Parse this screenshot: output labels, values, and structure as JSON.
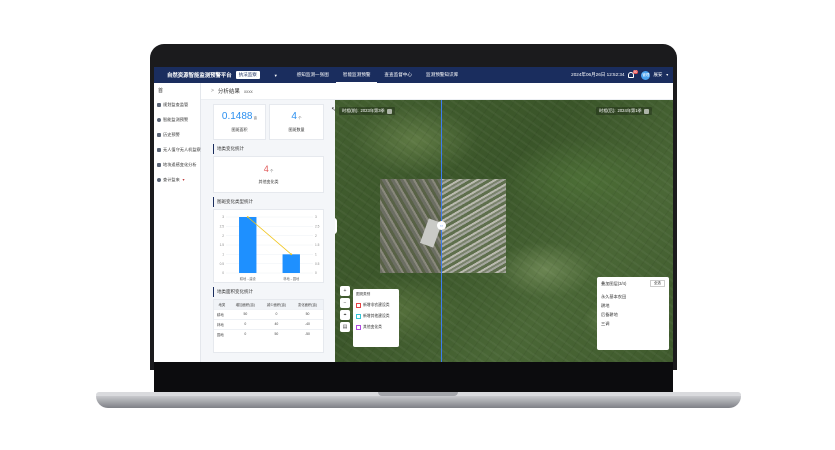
{
  "header": {
    "app_title": "自然资源智能监测预警平台",
    "mode_badge": "执法监察",
    "nav": [
      "感知监测一张图",
      "智能监测预警",
      "查查监督中心",
      "监测预警知识库"
    ],
    "active_nav_index": 1,
    "datetime": "2024年06月26日 12:52:34",
    "notification_count": "50",
    "user_initial": "管理",
    "user_name": "展安"
  },
  "sidebar": {
    "home_label": "首",
    "items": [
      {
        "label": "规划监查监管",
        "icon": "doc-icon"
      },
      {
        "label": "智能监测预警",
        "icon": "gear-icon"
      },
      {
        "label": "历史预警",
        "icon": "list-icon"
      },
      {
        "label": "无人值守无人机监察",
        "icon": "drone-icon"
      },
      {
        "label": "地块遥感变化分析",
        "icon": "monitor-icon"
      },
      {
        "label": "查计监来",
        "icon": "search-icon"
      }
    ]
  },
  "breadcrumb": {
    "title": "分析结果",
    "sub": "xxxx"
  },
  "stats": {
    "area_value": "0.1488",
    "area_unit": "亩",
    "area_label": "图斑面积",
    "count_value": "4",
    "count_unit": "个",
    "count_label": "图斑数量",
    "section_change": "地类变化统计",
    "change_value": "4",
    "change_unit": "个",
    "change_label": "其他变化类"
  },
  "chart_section_title": "图斑变化类型统计",
  "chart_data": {
    "type": "bar",
    "categories": [
      "耕地→建设",
      "林地→园地"
    ],
    "series": [
      {
        "values": [
          3,
          1
        ],
        "color": "#1e90ff"
      },
      {
        "values": [
          3,
          1
        ],
        "color": "#f0c419"
      }
    ],
    "ylim": [
      0,
      3
    ],
    "y_ticks": [
      "0",
      "0.5",
      "1",
      "1.5",
      "2",
      "2.5",
      "3"
    ],
    "y2_ticks": [
      "0",
      "0.5",
      "1",
      "1.5",
      "2",
      "2.5",
      "3"
    ]
  },
  "area_section_title": "地类面积变化统计",
  "area_table": {
    "headers": [
      "地类",
      "增加面积(亩)",
      "减少面积(亩)",
      "变化面积(亩)"
    ],
    "rows": [
      [
        "耕地",
        "50",
        "0",
        "50"
      ],
      [
        "林地",
        "0",
        "40",
        "-40"
      ],
      [
        "园地",
        "0",
        "50",
        "-50"
      ]
    ]
  },
  "map": {
    "left_time_label": "时相(前):",
    "left_time_value": "2023年第3季",
    "right_time_label": "时相(后):",
    "right_time_value": "2024年第1季",
    "legend_title": "图斑类别",
    "legend": [
      {
        "label": "新增非农建设类",
        "color": "#e64545"
      },
      {
        "label": "新增其他建设类",
        "color": "#35c6d6"
      },
      {
        "label": "其他变化类",
        "color": "#b14be0"
      }
    ],
    "layers_title": "叠加图层(3/4)",
    "layers_select": "全选",
    "layers": [
      "永久基本农田",
      "耕地",
      "后备耕地",
      "三调"
    ],
    "tools": [
      "zoom-in-icon",
      "zoom-out-icon",
      "locate-icon",
      "layers-icon"
    ]
  }
}
